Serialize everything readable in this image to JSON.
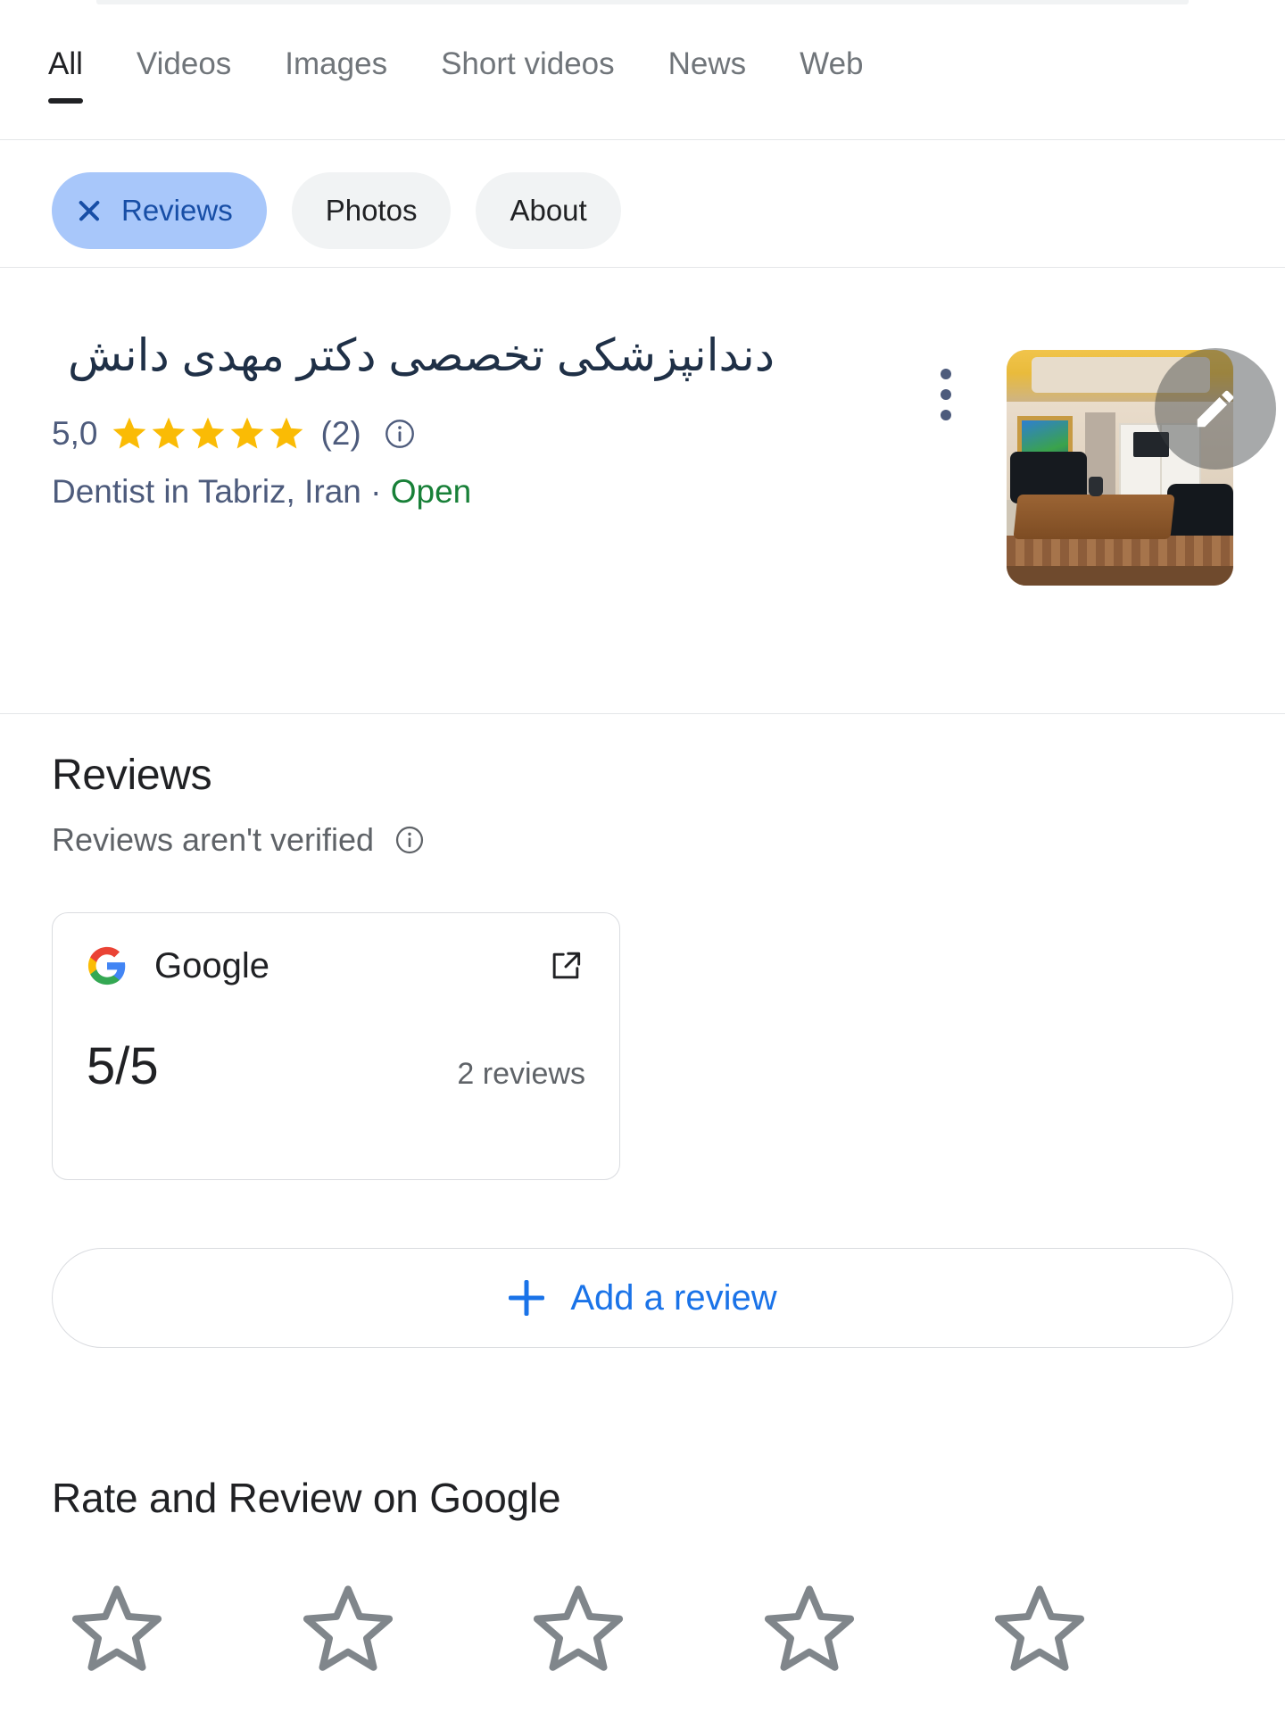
{
  "search_tabs": {
    "items": [
      {
        "label": "All",
        "active": true
      },
      {
        "label": "Videos",
        "active": false
      },
      {
        "label": "Images",
        "active": false
      },
      {
        "label": "Short videos",
        "active": false
      },
      {
        "label": "News",
        "active": false
      },
      {
        "label": "Web",
        "active": false
      }
    ]
  },
  "filter_chips": {
    "items": [
      {
        "label": "Reviews",
        "selected": true,
        "close_icon": "close-icon"
      },
      {
        "label": "Photos",
        "selected": false
      },
      {
        "label": "About",
        "selected": false
      }
    ]
  },
  "business": {
    "title": "دندانپزشکی تخصصی دکتر مهدی دانش",
    "rating_value": "5,0",
    "stars_filled": 5,
    "review_count_label": "(2)",
    "rating_info_icon": "info-icon",
    "category": "Dentist in Tabriz, Iran",
    "separator": "·",
    "status": "Open",
    "status_color": "#188038",
    "overflow_icon": "more-vert-icon",
    "edit_icon": "pencil-edit-icon",
    "photo_alt": "clinic-waiting-room-photo"
  },
  "reviews_section": {
    "heading": "Reviews",
    "disclaimer": "Reviews aren't verified",
    "disclaimer_icon": "info-icon",
    "source_card": {
      "brand": "Google",
      "brand_logo_icon": "google-g-icon",
      "open_icon": "open-in-new-icon",
      "score": "5/5",
      "count": "2 reviews"
    },
    "add_review": {
      "label": "Add a review",
      "icon": "plus-icon",
      "color": "#1a73e8"
    }
  },
  "rate_section": {
    "heading": "Rate and Review on Google",
    "star_count": 5,
    "star_icon": "star-outline-icon",
    "star_color": "#80868b"
  },
  "colors": {
    "accent_blue": "#1a73e8",
    "chip_selected_bg": "#a8c7fa",
    "chip_selected_text": "#174ea6",
    "chip_bg": "#f1f3f4",
    "star_gold": "#fabb05",
    "title_navy": "#1f3047",
    "meta_slate": "#4d5b7c",
    "open_green": "#188038",
    "text_primary": "#202124",
    "text_secondary": "#5f6368",
    "border": "#dadce0"
  }
}
